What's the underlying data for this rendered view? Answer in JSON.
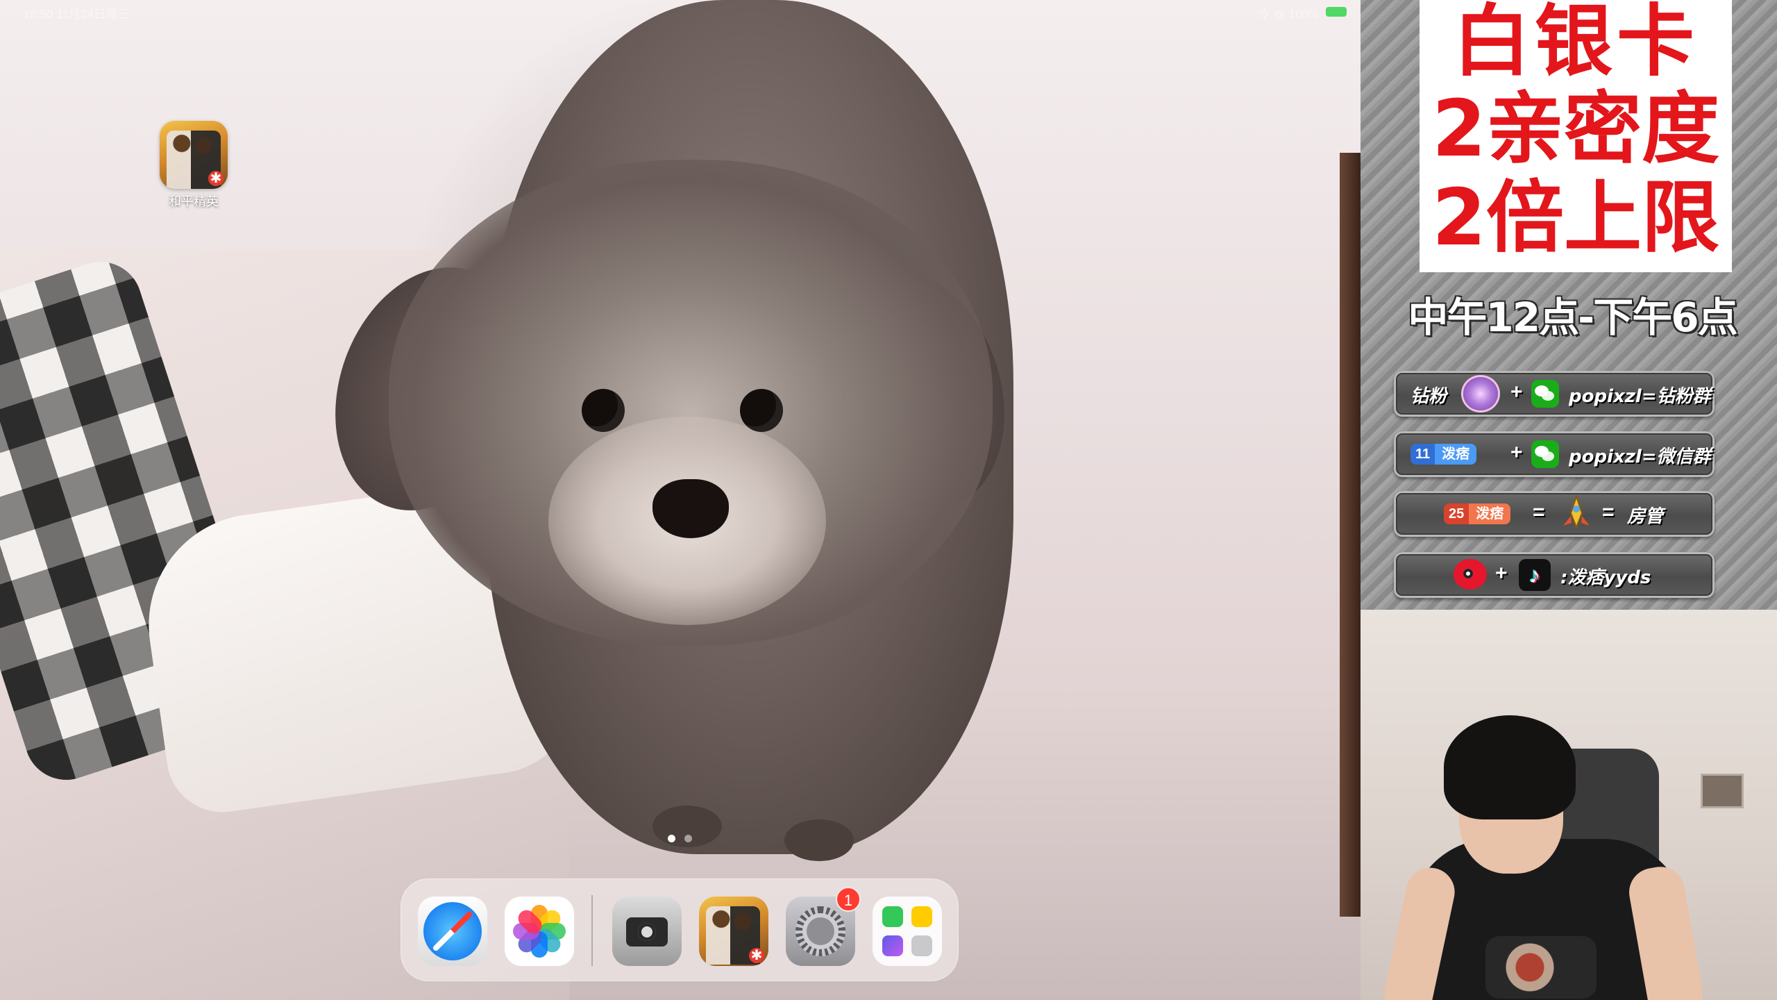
{
  "ipad": {
    "status": {
      "time": "18:50 11月24日周三",
      "right": "令 @ 100%"
    },
    "home_app": {
      "label": "和平精英",
      "icon": "pubg-icon"
    },
    "page_dots": {
      "count": 2,
      "active": 0
    },
    "dock": {
      "apps": [
        {
          "name": "Safari",
          "icon": "safari-icon"
        },
        {
          "name": "Photos",
          "icon": "photos-icon"
        },
        {
          "name": "Camera",
          "icon": "camera-icon"
        },
        {
          "name": "和平精英",
          "icon": "pubg-icon"
        },
        {
          "name": "Settings",
          "icon": "settings-icon",
          "badge": "1"
        },
        {
          "name": "Folder",
          "icon": "app-folder-icon"
        }
      ],
      "settings_badge": "1"
    },
    "wallpaper": "poodle-dog-photo"
  },
  "overlay": {
    "promo": {
      "line1": "白银卡",
      "line2": "2亲密度",
      "line3": "2倍上限",
      "color": "#e3161b"
    },
    "hours": "中午12点-下午6点",
    "plates": [
      {
        "left": "钻粉",
        "plus": "+",
        "right": "popixzl=钻粉群"
      },
      {
        "badge_num": "11",
        "badge_name": "泼痞",
        "plus": "+",
        "right": "popixzl=微信群"
      },
      {
        "badge_num": "25",
        "badge_name": "泼痞",
        "eq1": "=",
        "eq2": "=",
        "right": "房管"
      },
      {
        "plus": "+",
        "right": ":泼痞yyds"
      }
    ]
  },
  "webcam": {
    "description_icon": "streamer-webcam"
  }
}
